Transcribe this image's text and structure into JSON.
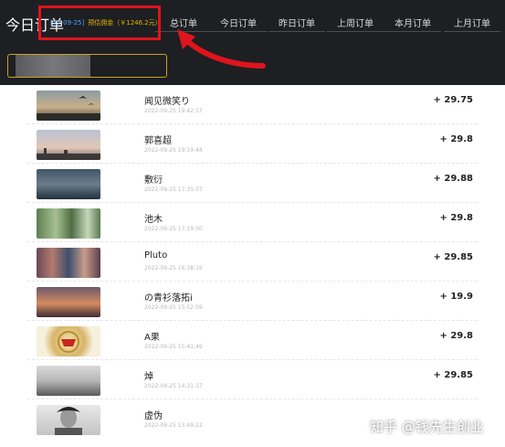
{
  "header": {
    "title": "今日订单",
    "tabs": [
      {
        "label": "总订单"
      },
      {
        "label": "今日订单"
      },
      {
        "label": "昨日订单"
      },
      {
        "label": "上周订单"
      },
      {
        "label": "本月订单"
      },
      {
        "label": "上月订单"
      }
    ],
    "commission": {
      "date": "[22-09-25]",
      "label": "预估佣金（￥1246.2元）"
    }
  },
  "colors": {
    "header_bg": "#1e1f22",
    "highlight": "#e0141d",
    "filter_border": "#c9a227",
    "commission_date": "#4aa3ff",
    "commission_label": "#e3b200"
  },
  "orders": [
    {
      "name": "闻见微笑り",
      "time": "2022-09-25 19:42:17",
      "amount": "+ 29.75",
      "thumb": "sunset-birds"
    },
    {
      "name": "郭喜超",
      "time": "2022-09-25 19:19:44",
      "amount": "+ 29.8",
      "thumb": "evening-sky"
    },
    {
      "name": "敷衍",
      "time": "2022-09-25 17:35:37",
      "amount": "+ 29.88",
      "thumb": "dark-landscape"
    },
    {
      "name": "池木",
      "time": "2022-09-25 17:19:50",
      "amount": "+ 29.8",
      "thumb": "palm-trees"
    },
    {
      "name": "Pluto",
      "time": "2022-09-25 16:38:19",
      "amount": "+ 29.85",
      "thumb": "crowd"
    },
    {
      "name": "の青衫落拓i",
      "time": "2022-09-25 15:52:59",
      "amount": "+ 19.9",
      "thumb": "sunset-clouds"
    },
    {
      "name": "A果",
      "time": "2022-09-25 15:41:49",
      "amount": "+ 29.8",
      "thumb": "badge-emblem"
    },
    {
      "name": "焯",
      "time": "2022-09-25 14:31:37",
      "amount": "+ 29.85",
      "thumb": "cloudy-sky"
    },
    {
      "name": "虚伪",
      "time": "2022-09-25 13:49:22",
      "amount": "",
      "thumb": "portrait"
    }
  ],
  "watermark": "知乎 @钱先生创业"
}
